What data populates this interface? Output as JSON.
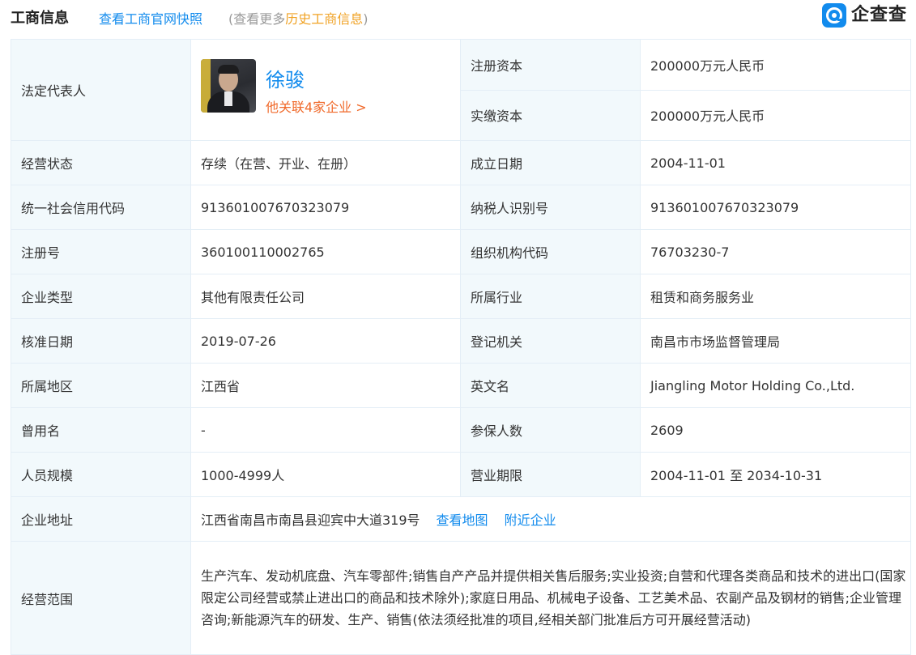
{
  "header": {
    "title": "工商信息",
    "snapshot_link": "查看工商官网快照",
    "history_prefix": "(查看更多",
    "history_link": "历史工商信息",
    "history_suffix": ")",
    "logo_text": "企查查"
  },
  "legal_rep": {
    "label": "法定代表人",
    "name": "徐骏",
    "related_link": "他关联4家企业 >"
  },
  "rows": {
    "registered_capital": {
      "label": "注册资本",
      "value": "200000万元人民币"
    },
    "paid_capital": {
      "label": "实缴资本",
      "value": "200000万元人民币"
    },
    "status": {
      "label": "经营状态",
      "value": "存续（在营、开业、在册）"
    },
    "founded": {
      "label": "成立日期",
      "value": "2004-11-01"
    },
    "credit_code": {
      "label": "统一社会信用代码",
      "value": "913601007670323079"
    },
    "taxpayer_id": {
      "label": "纳税人识别号",
      "value": "913601007670323079"
    },
    "reg_no": {
      "label": "注册号",
      "value": "360100110002765"
    },
    "org_code": {
      "label": "组织机构代码",
      "value": "76703230-7"
    },
    "company_type": {
      "label": "企业类型",
      "value": "其他有限责任公司"
    },
    "industry": {
      "label": "所属行业",
      "value": "租赁和商务服务业"
    },
    "approval_date": {
      "label": "核准日期",
      "value": "2019-07-26"
    },
    "reg_authority": {
      "label": "登记机关",
      "value": "南昌市市场监督管理局"
    },
    "region": {
      "label": "所属地区",
      "value": "江西省"
    },
    "english_name": {
      "label": "英文名",
      "value": "Jiangling Motor Holding Co.,Ltd."
    },
    "former_name": {
      "label": "曾用名",
      "value": "-"
    },
    "insured": {
      "label": "参保人数",
      "value": "2609"
    },
    "staff_size": {
      "label": "人员规模",
      "value": "1000-4999人"
    },
    "business_term": {
      "label": "营业期限",
      "value": "2004-11-01 至 2034-10-31"
    },
    "address": {
      "label": "企业地址",
      "value": "江西省南昌市南昌县迎宾中大道319号",
      "map_link": "查看地图",
      "nearby_link": "附近企业"
    },
    "scope": {
      "label": "经营范围",
      "value": "生产汽车、发动机底盘、汽车零部件;销售自产产品并提供相关售后服务;实业投资;自营和代理各类商品和技术的进出口(国家限定公司经营或禁止进出口的商品和技术除外);家庭日用品、机械电子设备、工艺美术品、农副产品及钢材的销售;企业管理咨询;新能源汽车的研发、生产、销售(依法须经批准的项目,经相关部门批准后方可开展经营活动)"
    }
  },
  "colors": {
    "accent": "#128bed",
    "orange": "#f0a224",
    "link_red": "#f06a2b",
    "label_bg": "#f2f9fc",
    "border": "#e4eef6"
  }
}
